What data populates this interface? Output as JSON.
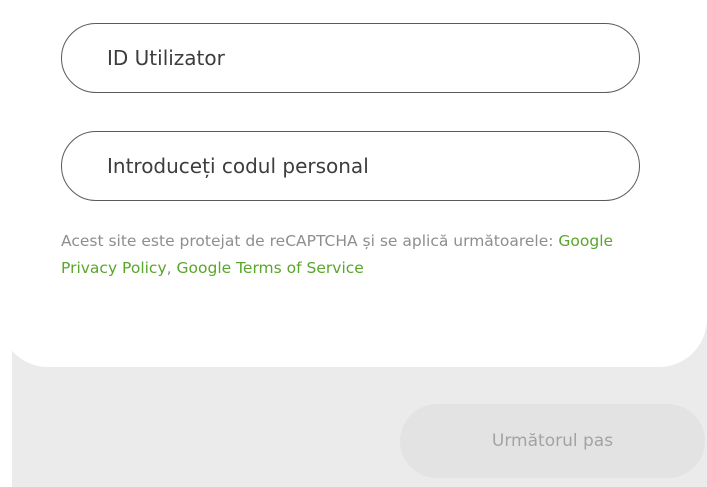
{
  "form": {
    "user_id_placeholder": "ID Utilizator",
    "personal_code_placeholder": "Introduceți codul personal",
    "notice_text": "Acest site este protejat de reCAPTCHA și se aplică următoarele: ",
    "privacy_link": "Google Privacy Policy",
    "separator": ", ",
    "terms_link": "Google Terms of Service",
    "next_button": "Următorul pas"
  },
  "colors": {
    "link": "#5aa52b",
    "field_border": "#5a5a5a",
    "background": "#ebebeb",
    "button_bg": "#e3e3e3",
    "button_text": "#a3a3a3"
  }
}
